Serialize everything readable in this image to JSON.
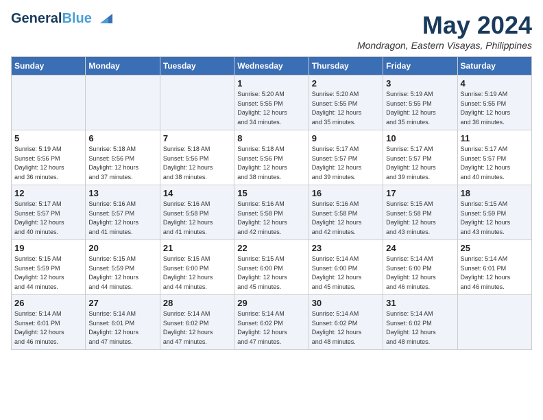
{
  "header": {
    "logo_line1": "General",
    "logo_line2": "Blue",
    "month_title": "May 2024",
    "location": "Mondragon, Eastern Visayas, Philippines"
  },
  "days_of_week": [
    "Sunday",
    "Monday",
    "Tuesday",
    "Wednesday",
    "Thursday",
    "Friday",
    "Saturday"
  ],
  "weeks": [
    [
      {
        "day": "",
        "info": ""
      },
      {
        "day": "",
        "info": ""
      },
      {
        "day": "",
        "info": ""
      },
      {
        "day": "1",
        "info": "Sunrise: 5:20 AM\nSunset: 5:55 PM\nDaylight: 12 hours\nand 34 minutes."
      },
      {
        "day": "2",
        "info": "Sunrise: 5:20 AM\nSunset: 5:55 PM\nDaylight: 12 hours\nand 35 minutes."
      },
      {
        "day": "3",
        "info": "Sunrise: 5:19 AM\nSunset: 5:55 PM\nDaylight: 12 hours\nand 35 minutes."
      },
      {
        "day": "4",
        "info": "Sunrise: 5:19 AM\nSunset: 5:55 PM\nDaylight: 12 hours\nand 36 minutes."
      }
    ],
    [
      {
        "day": "5",
        "info": "Sunrise: 5:19 AM\nSunset: 5:56 PM\nDaylight: 12 hours\nand 36 minutes."
      },
      {
        "day": "6",
        "info": "Sunrise: 5:18 AM\nSunset: 5:56 PM\nDaylight: 12 hours\nand 37 minutes."
      },
      {
        "day": "7",
        "info": "Sunrise: 5:18 AM\nSunset: 5:56 PM\nDaylight: 12 hours\nand 38 minutes."
      },
      {
        "day": "8",
        "info": "Sunrise: 5:18 AM\nSunset: 5:56 PM\nDaylight: 12 hours\nand 38 minutes."
      },
      {
        "day": "9",
        "info": "Sunrise: 5:17 AM\nSunset: 5:57 PM\nDaylight: 12 hours\nand 39 minutes."
      },
      {
        "day": "10",
        "info": "Sunrise: 5:17 AM\nSunset: 5:57 PM\nDaylight: 12 hours\nand 39 minutes."
      },
      {
        "day": "11",
        "info": "Sunrise: 5:17 AM\nSunset: 5:57 PM\nDaylight: 12 hours\nand 40 minutes."
      }
    ],
    [
      {
        "day": "12",
        "info": "Sunrise: 5:17 AM\nSunset: 5:57 PM\nDaylight: 12 hours\nand 40 minutes."
      },
      {
        "day": "13",
        "info": "Sunrise: 5:16 AM\nSunset: 5:57 PM\nDaylight: 12 hours\nand 41 minutes."
      },
      {
        "day": "14",
        "info": "Sunrise: 5:16 AM\nSunset: 5:58 PM\nDaylight: 12 hours\nand 41 minutes."
      },
      {
        "day": "15",
        "info": "Sunrise: 5:16 AM\nSunset: 5:58 PM\nDaylight: 12 hours\nand 42 minutes."
      },
      {
        "day": "16",
        "info": "Sunrise: 5:16 AM\nSunset: 5:58 PM\nDaylight: 12 hours\nand 42 minutes."
      },
      {
        "day": "17",
        "info": "Sunrise: 5:15 AM\nSunset: 5:58 PM\nDaylight: 12 hours\nand 43 minutes."
      },
      {
        "day": "18",
        "info": "Sunrise: 5:15 AM\nSunset: 5:59 PM\nDaylight: 12 hours\nand 43 minutes."
      }
    ],
    [
      {
        "day": "19",
        "info": "Sunrise: 5:15 AM\nSunset: 5:59 PM\nDaylight: 12 hours\nand 44 minutes."
      },
      {
        "day": "20",
        "info": "Sunrise: 5:15 AM\nSunset: 5:59 PM\nDaylight: 12 hours\nand 44 minutes."
      },
      {
        "day": "21",
        "info": "Sunrise: 5:15 AM\nSunset: 6:00 PM\nDaylight: 12 hours\nand 44 minutes."
      },
      {
        "day": "22",
        "info": "Sunrise: 5:15 AM\nSunset: 6:00 PM\nDaylight: 12 hours\nand 45 minutes."
      },
      {
        "day": "23",
        "info": "Sunrise: 5:14 AM\nSunset: 6:00 PM\nDaylight: 12 hours\nand 45 minutes."
      },
      {
        "day": "24",
        "info": "Sunrise: 5:14 AM\nSunset: 6:00 PM\nDaylight: 12 hours\nand 46 minutes."
      },
      {
        "day": "25",
        "info": "Sunrise: 5:14 AM\nSunset: 6:01 PM\nDaylight: 12 hours\nand 46 minutes."
      }
    ],
    [
      {
        "day": "26",
        "info": "Sunrise: 5:14 AM\nSunset: 6:01 PM\nDaylight: 12 hours\nand 46 minutes."
      },
      {
        "day": "27",
        "info": "Sunrise: 5:14 AM\nSunset: 6:01 PM\nDaylight: 12 hours\nand 47 minutes."
      },
      {
        "day": "28",
        "info": "Sunrise: 5:14 AM\nSunset: 6:02 PM\nDaylight: 12 hours\nand 47 minutes."
      },
      {
        "day": "29",
        "info": "Sunrise: 5:14 AM\nSunset: 6:02 PM\nDaylight: 12 hours\nand 47 minutes."
      },
      {
        "day": "30",
        "info": "Sunrise: 5:14 AM\nSunset: 6:02 PM\nDaylight: 12 hours\nand 48 minutes."
      },
      {
        "day": "31",
        "info": "Sunrise: 5:14 AM\nSunset: 6:02 PM\nDaylight: 12 hours\nand 48 minutes."
      },
      {
        "day": "",
        "info": ""
      }
    ]
  ]
}
